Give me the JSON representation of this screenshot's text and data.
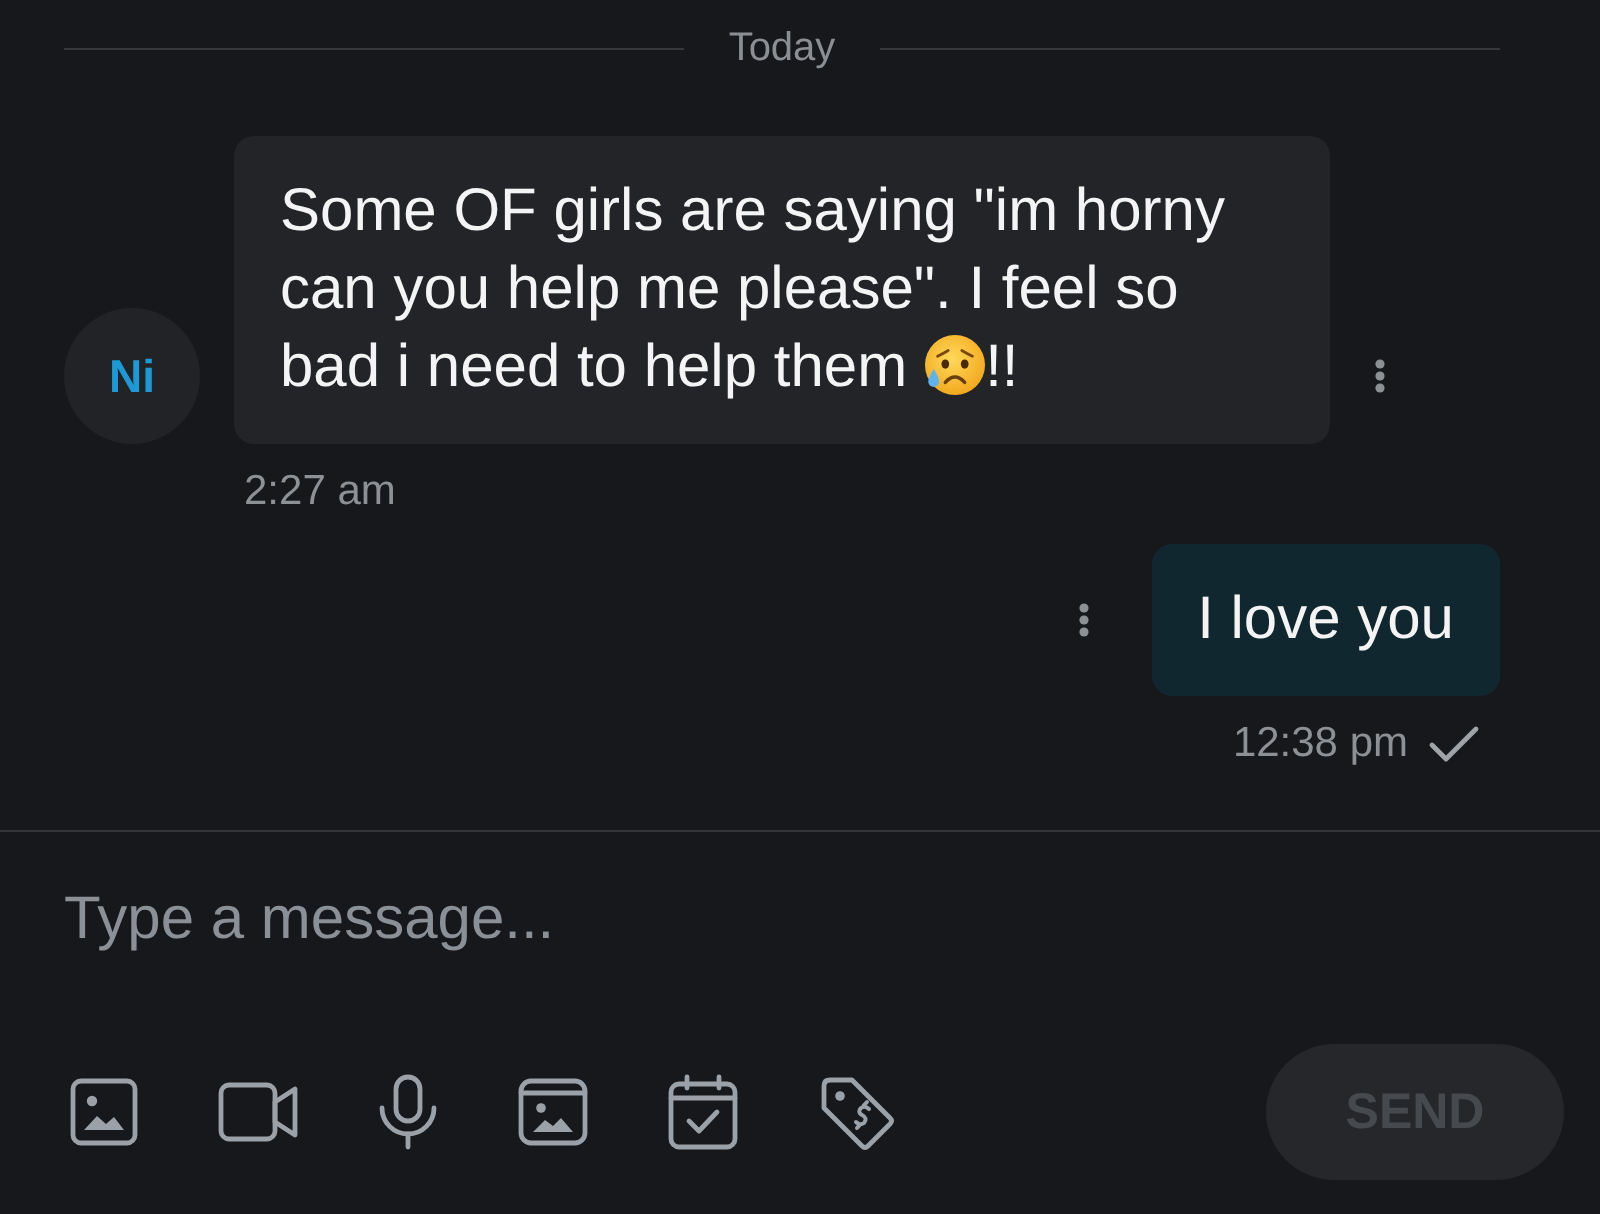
{
  "date_divider": {
    "label": "Today"
  },
  "messages": [
    {
      "kind": "incoming",
      "avatar": {
        "initials": "Ni"
      },
      "blocks": [
        [
          {
            "kind": "text",
            "text": "Some OF girls are saying \"im horny can you help me please\". I feel so"
          }
        ],
        [
          {
            "kind": "text",
            "text": "bad i need to help them"
          },
          {
            "kind": "emoji"
          },
          {
            "kind": "text",
            "text": "!!"
          }
        ]
      ],
      "time": "2:27 am"
    },
    {
      "kind": "outgoing",
      "blocks": [
        [
          {
            "kind": "text",
            "text": "I love you"
          }
        ]
      ],
      "time": "12:38 pm",
      "sent": true
    }
  ],
  "composer": {
    "placeholder": "Type a message...",
    "send": {
      "label": "SEND",
      "disabled": true
    }
  }
}
